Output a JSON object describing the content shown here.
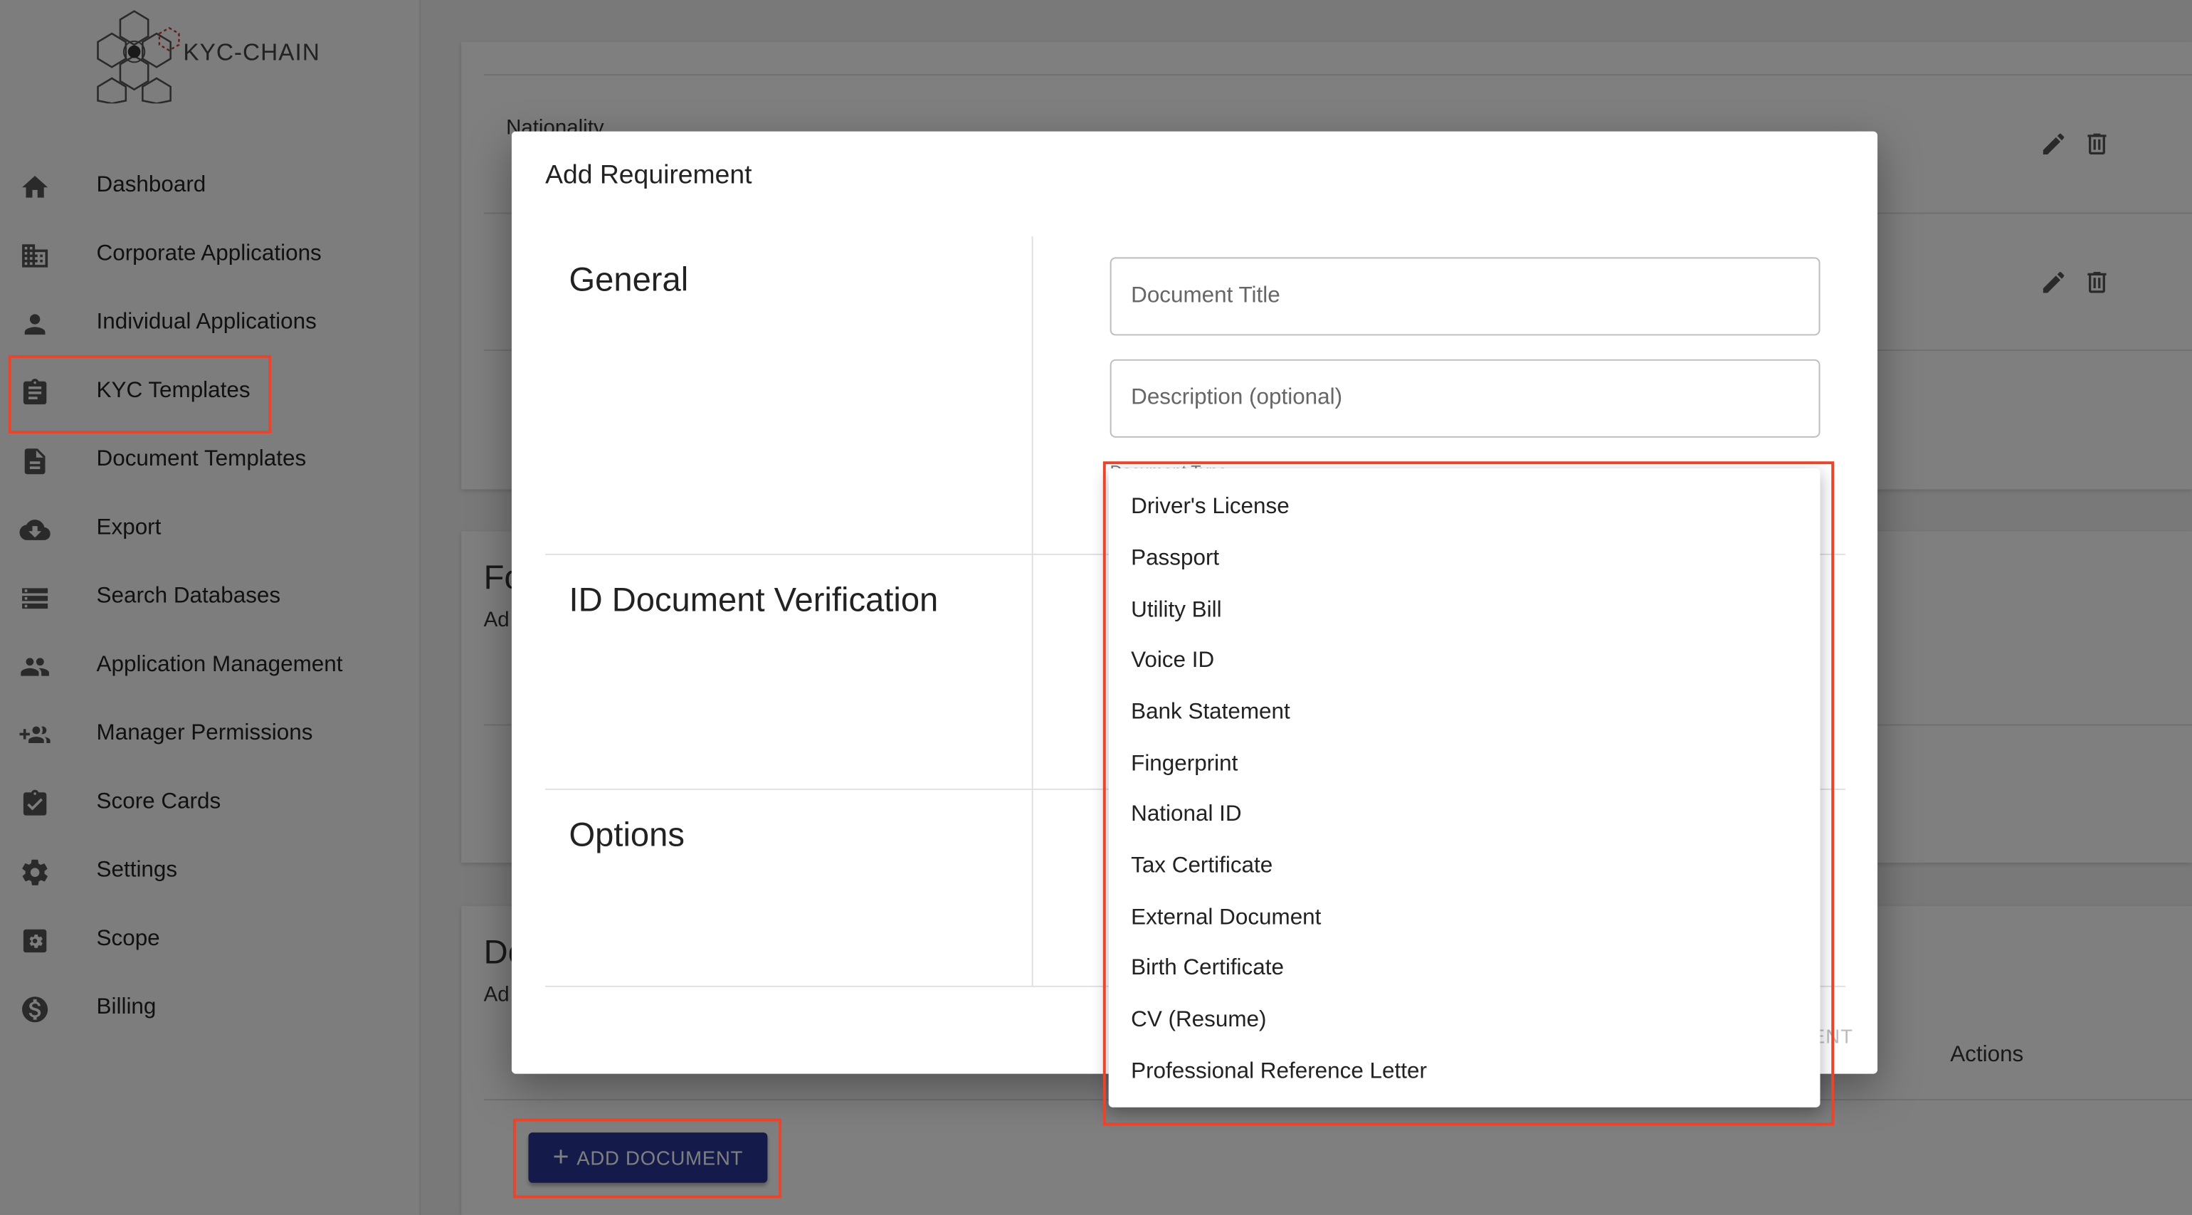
{
  "brand": {
    "name": "KYC-CHAIN"
  },
  "sidebar": {
    "items": [
      {
        "label": "Dashboard",
        "icon": "home-icon"
      },
      {
        "label": "Corporate Applications",
        "icon": "building-icon"
      },
      {
        "label": "Individual Applications",
        "icon": "person-icon"
      },
      {
        "label": "KYC Templates",
        "icon": "clipboard-icon"
      },
      {
        "label": "Document Templates",
        "icon": "document-icon"
      },
      {
        "label": "Export",
        "icon": "cloud-download-icon"
      },
      {
        "label": "Search Databases",
        "icon": "storage-icon"
      },
      {
        "label": "Application Management",
        "icon": "people-icon"
      },
      {
        "label": "Manager Permissions",
        "icon": "group-add-icon"
      },
      {
        "label": "Score Cards",
        "icon": "assignment-check-icon"
      },
      {
        "label": "Settings",
        "icon": "gear-icon"
      },
      {
        "label": "Scope",
        "icon": "settings-box-icon"
      },
      {
        "label": "Billing",
        "icon": "dollar-icon"
      }
    ]
  },
  "background": {
    "nationality_label": "Nationality",
    "section_fo_partial": "Fo",
    "section_fo_sub_partial": "Ad",
    "section_do_partial": "Do",
    "section_do_sub_partial": "Ad",
    "actions_header": "Actions",
    "add_document_label": "ADD DOCUMENT"
  },
  "modal": {
    "title": "Add Requirement",
    "sections": {
      "general": "General",
      "id_verification": "ID Document Verification",
      "options": "Options"
    },
    "fields": {
      "document_title_placeholder": "Document Title",
      "description_placeholder": "Description (optional)",
      "document_type_label": "Document Type"
    },
    "ghost_button_partial": "ENT"
  },
  "dropdown": {
    "options": [
      "Driver's License",
      "Passport",
      "Utility Bill",
      "Voice ID",
      "Bank Statement",
      "Fingerprint",
      "National ID",
      "Tax Certificate",
      "External Document",
      "Birth Certificate",
      "CV (Resume)",
      "Professional Reference Letter"
    ]
  },
  "colors": {
    "primary_button": "#283593",
    "highlight": "#e8452c",
    "sidebar_bg": "#fafafa"
  }
}
